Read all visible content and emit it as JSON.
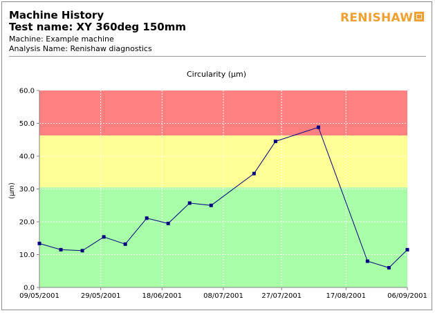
{
  "header": {
    "title": "Machine History",
    "test_name": "Test name: XY 360deg 150mm",
    "machine": "Machine: Example machine",
    "analysis": "Analysis Name: Renishaw diagnostics",
    "logo": "RENISHAW"
  },
  "colors": {
    "red_band": "#ff8080",
    "yellow_band": "#ffff96",
    "green_band": "#a8ffa8",
    "line": "#000080",
    "marker": "#000080"
  },
  "chart_data": {
    "type": "line",
    "title": "Circularity (µm)",
    "ylabel": "(µm)",
    "xlabel": "",
    "ylim": [
      0,
      60
    ],
    "y_ticks": [
      "0.0",
      "10.0",
      "20.0",
      "30.0",
      "40.0",
      "50.0",
      "60.0"
    ],
    "xlim": [
      "2001-05-09",
      "2001-09-06"
    ],
    "x_ticks": [
      "09/05/2001",
      "29/05/2001",
      "18/06/2001",
      "08/07/2001",
      "27/07/2001",
      "17/08/2001",
      "06/09/2001"
    ],
    "bands": [
      {
        "from": 0,
        "to": 30.5,
        "color": "green"
      },
      {
        "from": 30.5,
        "to": 46.3,
        "color": "yellow"
      },
      {
        "from": 46.3,
        "to": 60,
        "color": "red"
      }
    ],
    "grid": true,
    "series": [
      {
        "x": [
          "2001-05-09",
          "2001-05-16",
          "2001-05-23",
          "2001-05-30",
          "2001-06-06",
          "2001-06-13",
          "2001-06-20",
          "2001-06-27",
          "2001-07-04",
          "2001-07-18",
          "2001-07-25",
          "2001-08-08",
          "2001-08-24",
          "2001-08-31",
          "2001-09-06"
        ],
        "y": [
          13.4,
          11.5,
          11.2,
          15.4,
          13.2,
          21.1,
          19.5,
          25.7,
          25.0,
          34.7,
          44.5,
          48.8,
          8.0,
          6.0,
          11.5
        ]
      }
    ]
  }
}
